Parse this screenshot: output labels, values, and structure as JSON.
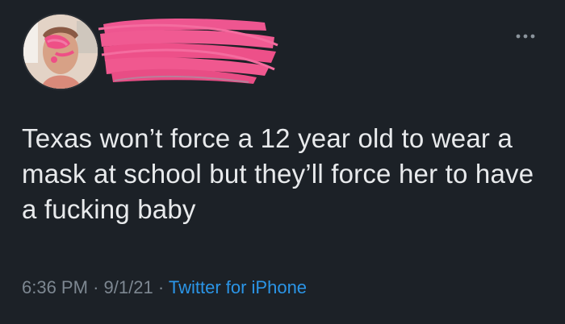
{
  "tweet": {
    "author": {
      "avatar_icon": "profile-photo-redacted",
      "redaction_color": "#f0548f"
    },
    "more_icon": "more-horizontal-icon",
    "text": "Texas won’t force a 12 year old to wear a mask at school but they’ll force her to have a fucking baby",
    "time": "6:36 PM",
    "date": "9/1/21",
    "separator": "·",
    "source": "Twitter for iPhone"
  },
  "colors": {
    "background": "#1c2127",
    "text": "#e8eaec",
    "muted": "#7d8791",
    "link": "#2b95e7"
  }
}
